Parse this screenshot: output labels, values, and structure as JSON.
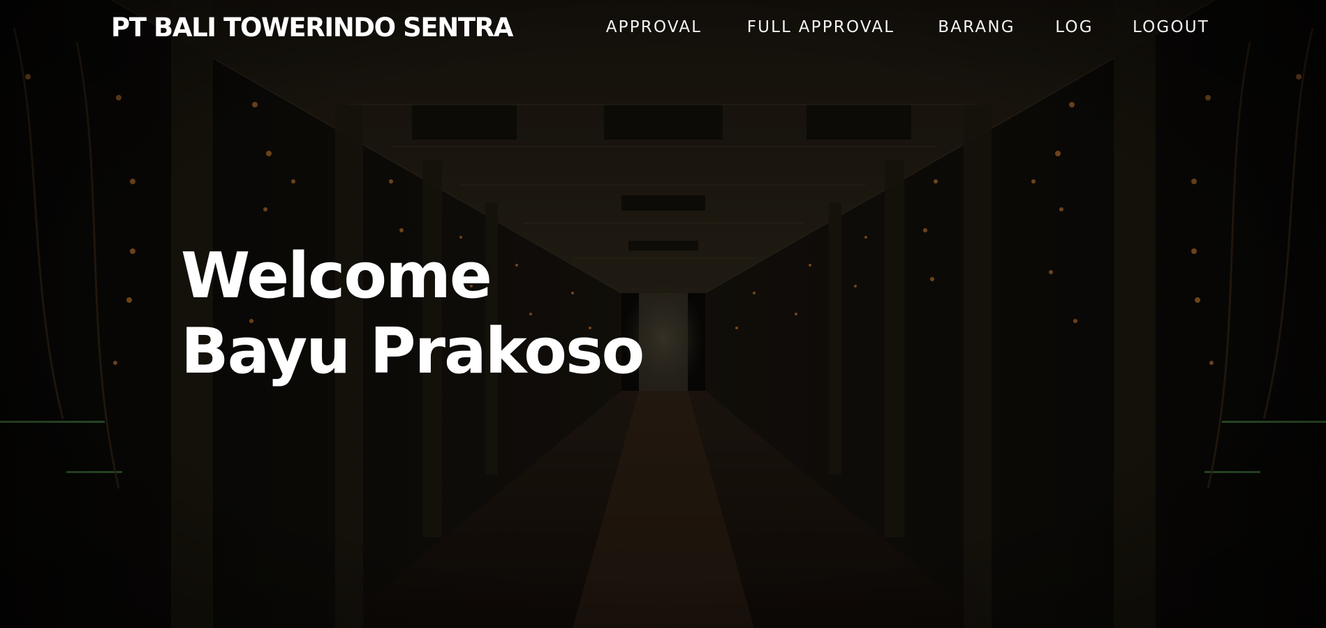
{
  "brand": {
    "title": "PT BALI TOWERINDO SENTRA"
  },
  "nav": {
    "items": [
      {
        "label": "APPROVAL"
      },
      {
        "label": "FULL APPROVAL"
      },
      {
        "label": "BARANG"
      },
      {
        "label": "LOG"
      },
      {
        "label": "LOGOUT"
      }
    ]
  },
  "hero": {
    "line1": "Welcome",
    "line2": "Bayu Prakoso",
    "background": "server-room-corridor-image"
  },
  "colors": {
    "text": "#ffffff",
    "overlay": "#000000",
    "rack_light": "#ff9a3c",
    "rack_green": "#6fd36a"
  }
}
